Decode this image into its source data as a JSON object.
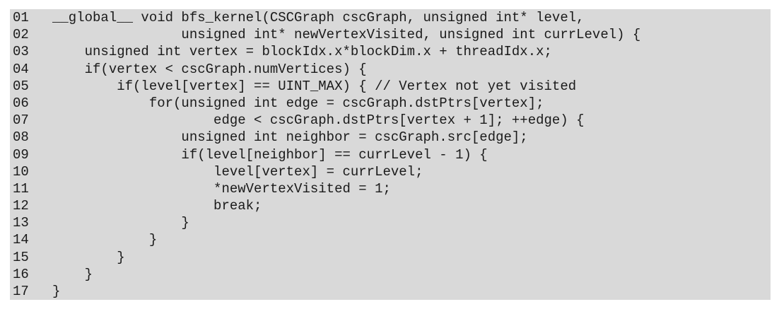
{
  "code": {
    "lines": [
      {
        "num": "01",
        "text": "__global__ void bfs_kernel(CSCGraph cscGraph, unsigned int* level,"
      },
      {
        "num": "02",
        "text": "                unsigned int* newVertexVisited, unsigned int currLevel) {"
      },
      {
        "num": "03",
        "text": "    unsigned int vertex = blockIdx.x*blockDim.x + threadIdx.x;"
      },
      {
        "num": "04",
        "text": "    if(vertex < cscGraph.numVertices) {"
      },
      {
        "num": "05",
        "text": "        if(level[vertex] == UINT_MAX) { // Vertex not yet visited"
      },
      {
        "num": "06",
        "text": "            for(unsigned int edge = cscGraph.dstPtrs[vertex];"
      },
      {
        "num": "07",
        "text": "                    edge < cscGraph.dstPtrs[vertex + 1]; ++edge) {"
      },
      {
        "num": "08",
        "text": "                unsigned int neighbor = cscGraph.src[edge];"
      },
      {
        "num": "09",
        "text": "                if(level[neighbor] == currLevel - 1) {"
      },
      {
        "num": "10",
        "text": "                    level[vertex] = currLevel;"
      },
      {
        "num": "11",
        "text": "                    *newVertexVisited = 1;"
      },
      {
        "num": "12",
        "text": "                    break;"
      },
      {
        "num": "13",
        "text": "                }"
      },
      {
        "num": "14",
        "text": "            }"
      },
      {
        "num": "15",
        "text": "        }"
      },
      {
        "num": "16",
        "text": "    }"
      },
      {
        "num": "17",
        "text": "}"
      }
    ]
  }
}
